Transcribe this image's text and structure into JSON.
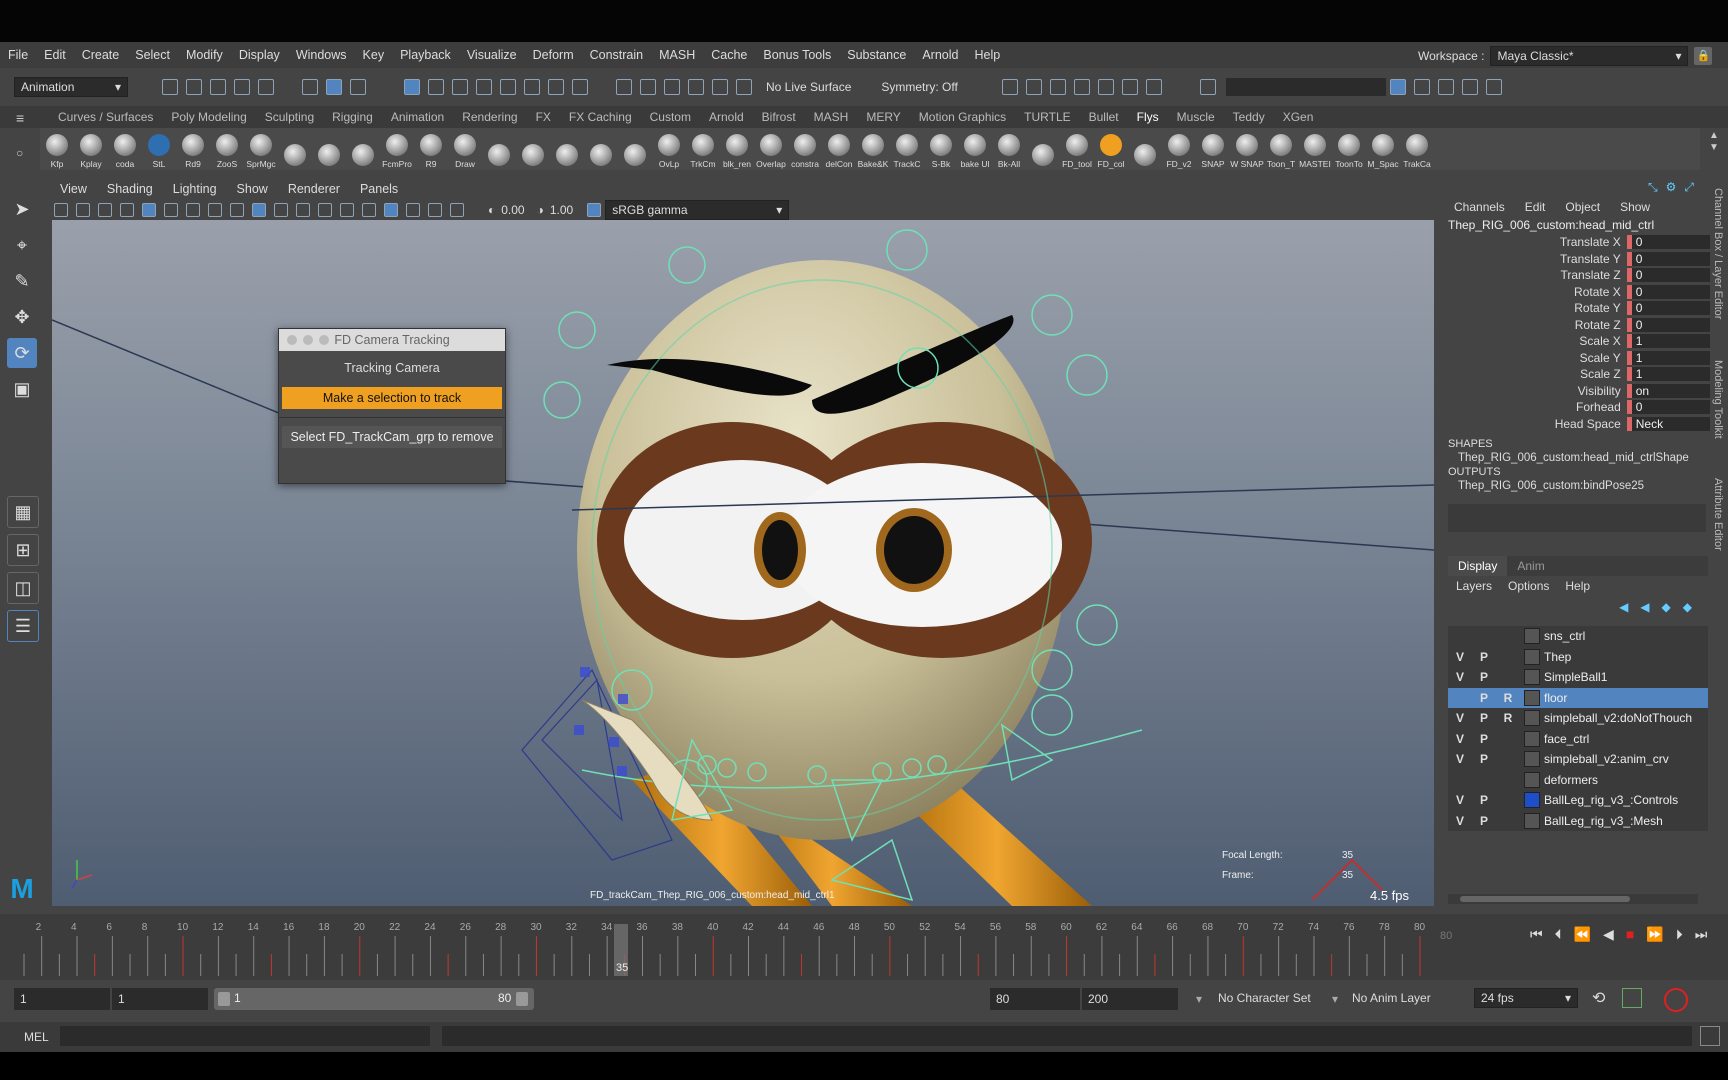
{
  "menu": [
    "File",
    "Edit",
    "Create",
    "Select",
    "Modify",
    "Display",
    "Windows",
    "Key",
    "Playback",
    "Visualize",
    "Deform",
    "Constrain",
    "MASH",
    "Cache",
    "Bonus Tools",
    "Substance",
    "Arnold",
    "Help"
  ],
  "workspace": {
    "label": "Workspace :",
    "value": "Maya Classic*"
  },
  "toolbar": {
    "mode": "Animation",
    "live_surface": "No Live Surface",
    "symmetry": "Symmetry: Off"
  },
  "shelf_tabs": [
    "Curves / Surfaces",
    "Poly Modeling",
    "Sculpting",
    "Rigging",
    "Animation",
    "Rendering",
    "FX",
    "FX Caching",
    "Custom",
    "Arnold",
    "Bifrost",
    "MASH",
    "MERY",
    "Motion Graphics",
    "TURTLE",
    "Bullet",
    "Flys",
    "Muscle",
    "Teddy",
    "XGen"
  ],
  "shelf_active": "Flys",
  "shelf_items": [
    "Kfp",
    "Kplay",
    "coda",
    "StL",
    "Rd9",
    "ZooS",
    "SprMgc",
    "",
    "",
    "",
    "FcmPro",
    "R9",
    "Draw",
    "",
    "",
    "",
    "",
    "",
    "OvLp",
    "TrkCm",
    "blk_ren",
    "Overlap",
    "constra",
    "delCon",
    "Bake&K",
    "TrackC",
    "S-Bk",
    "bake Ul",
    "Bk-All",
    "",
    "FD_tool",
    "FD_col",
    "",
    "FD_v2",
    "SNAP",
    "W SNAP",
    "Toon_T",
    "MASTEI",
    "ToonTo",
    "M_Spac",
    "TrakCa"
  ],
  "viewport": {
    "menu": [
      "View",
      "Shading",
      "Lighting",
      "Show",
      "Renderer",
      "Panels"
    ],
    "exposure": "0.00",
    "gamma": "1.00",
    "color_space": "sRGB gamma",
    "camera_label": "FD_trackCam_Thep_RIG_006_custom:head_mid_ctrl1",
    "focal_label": "Focal Length:",
    "focal_value": "35",
    "frame_label": "Frame:",
    "frame_value": "35",
    "fps": "4.5 fps"
  },
  "dialog": {
    "title": "FD Camera Tracking",
    "heading": "Tracking Camera",
    "track_button": "Make a selection to track",
    "remove_button": "Select FD_TrackCam_grp to remove"
  },
  "channel_box": {
    "menu": [
      "Channels",
      "Edit",
      "Object",
      "Show"
    ],
    "node": "Thep_RIG_006_custom:head_mid_ctrl",
    "channels": [
      {
        "name": "Translate X",
        "value": "0"
      },
      {
        "name": "Translate Y",
        "value": "0"
      },
      {
        "name": "Translate Z",
        "value": "0"
      },
      {
        "name": "Rotate X",
        "value": "0"
      },
      {
        "name": "Rotate Y",
        "value": "0"
      },
      {
        "name": "Rotate Z",
        "value": "0"
      },
      {
        "name": "Scale X",
        "value": "1"
      },
      {
        "name": "Scale Y",
        "value": "1"
      },
      {
        "name": "Scale Z",
        "value": "1"
      },
      {
        "name": "Visibility",
        "value": "on"
      },
      {
        "name": "Forhead",
        "value": "0"
      },
      {
        "name": "Head Space",
        "value": "Neck"
      }
    ],
    "shapes_label": "SHAPES",
    "shape": "Thep_RIG_006_custom:head_mid_ctrlShape",
    "outputs_label": "OUTPUTS",
    "output": "Thep_RIG_006_custom:bindPose25"
  },
  "side_tabs": [
    "Channel Box / Layer Editor",
    "Modeling Toolkit",
    "Attribute Editor"
  ],
  "layer_editor": {
    "tabs": [
      "Display",
      "Anim"
    ],
    "menu": [
      "Layers",
      "Options",
      "Help"
    ],
    "layers": [
      {
        "v": "",
        "p": "",
        "r": "",
        "name": "sns_ctrl",
        "color": "#555555",
        "selected": false
      },
      {
        "v": "V",
        "p": "P",
        "r": "",
        "name": "Thep",
        "color": "#555555",
        "selected": false
      },
      {
        "v": "V",
        "p": "P",
        "r": "",
        "name": "SimpleBall1",
        "color": "#555555",
        "selected": false
      },
      {
        "v": "",
        "p": "P",
        "r": "R",
        "name": "floor",
        "color": "#555555",
        "selected": true
      },
      {
        "v": "V",
        "p": "P",
        "r": "R",
        "name": "simpleball_v2:doNotThouch",
        "color": "#555555",
        "selected": false
      },
      {
        "v": "V",
        "p": "P",
        "r": "",
        "name": "face_ctrl",
        "color": "#555555",
        "selected": false
      },
      {
        "v": "V",
        "p": "P",
        "r": "",
        "name": "simpleball_v2:anim_crv",
        "color": "#555555",
        "selected": false
      },
      {
        "v": "",
        "p": "",
        "r": "",
        "name": "deformers",
        "color": "#555555",
        "selected": false
      },
      {
        "v": "V",
        "p": "P",
        "r": "",
        "name": "BallLeg_rig_v3_:Controls",
        "color": "#1f4fc8",
        "selected": false
      },
      {
        "v": "V",
        "p": "P",
        "r": "",
        "name": "BallLeg_rig_v3_:Mesh",
        "color": "#555555",
        "selected": false
      }
    ]
  },
  "timeline": {
    "ticks": [
      "2",
      "4",
      "6",
      "8",
      "10",
      "12",
      "14",
      "16",
      "18",
      "20",
      "22",
      "24",
      "26",
      "28",
      "30",
      "32",
      "34",
      "36",
      "38",
      "40",
      "42",
      "44",
      "46",
      "48",
      "50",
      "52",
      "54",
      "56",
      "58",
      "60",
      "62",
      "64",
      "66",
      "68",
      "70",
      "72",
      "74",
      "76",
      "78",
      "80"
    ],
    "current_frame": "35",
    "end_readout": "80"
  },
  "range": {
    "start": "1",
    "playback_start": "1",
    "slider_start": "1",
    "slider_end": "80",
    "playback_end": "80",
    "end": "200",
    "character_set": "No Character Set",
    "anim_layer": "No Anim Layer",
    "fps": "24 fps"
  },
  "command_line": {
    "label": "MEL"
  },
  "colors": {
    "accent_orange": "#f0a020",
    "selection_blue": "#5285c0",
    "maya_blue": "#1aa0e0"
  }
}
